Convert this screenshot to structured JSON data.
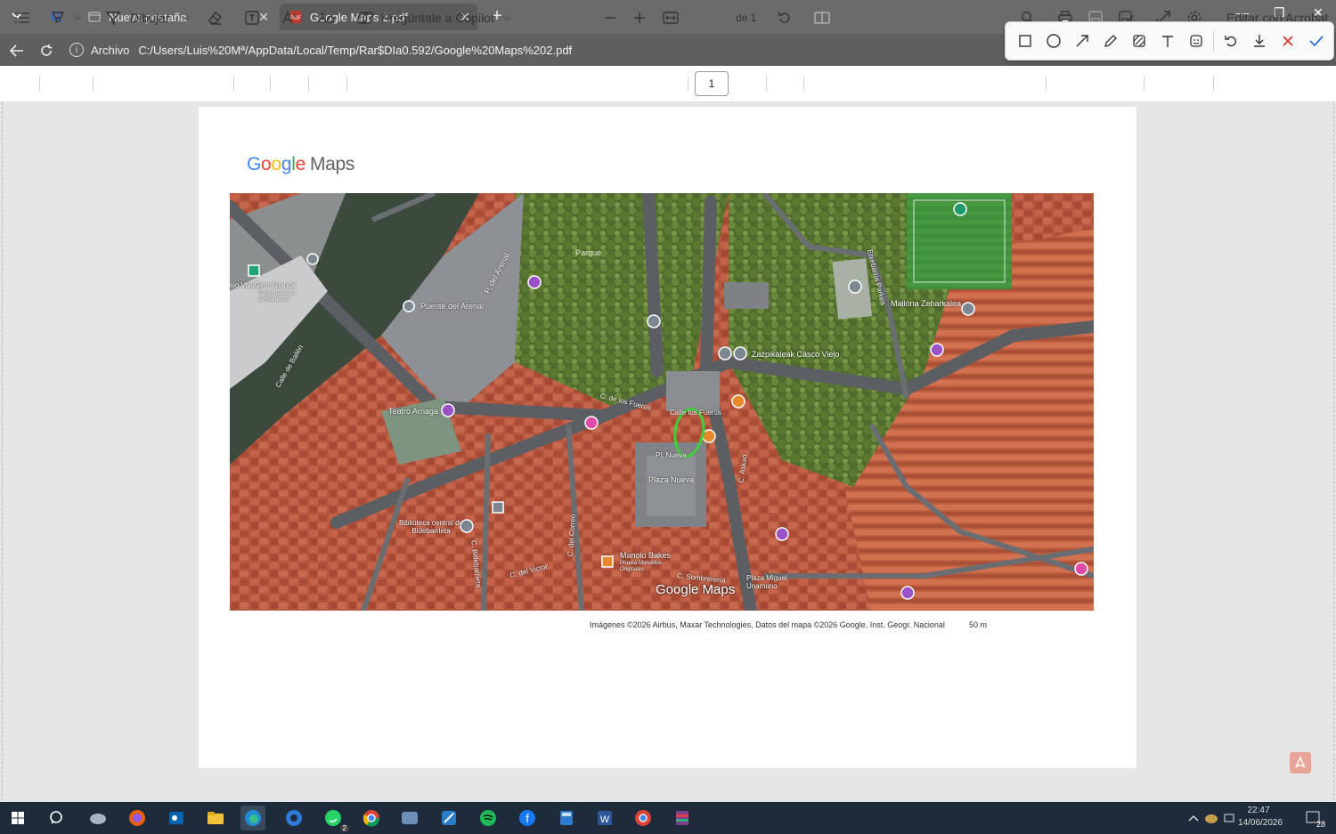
{
  "tabs": [
    {
      "label": "Nueva pestaña"
    },
    {
      "label": "Google Maps 2.pdf"
    }
  ],
  "address": {
    "scheme_label": "Archivo",
    "url": "C:/Users/Luis%20Mª/AppData/Local/Temp/Rar$DIa0.592/Google%20Maps%202.pdf"
  },
  "pdf_toolbar": {
    "draw_label": "Dibujar",
    "copilot_label": "Pregúntale a Copilot",
    "page_current": "1",
    "page_total": "de 1",
    "edit_acrobat_label": "Editar con Acrobat"
  },
  "document": {
    "logo_google": [
      "G",
      "o",
      "o",
      "g",
      "l",
      "e"
    ],
    "logo_maps": "Maps",
    "attribution": "Imágenes ©2026 Airbus, Maxar Technologies, Datos del mapa ©2026 Google, Inst. Geogr. Nacional",
    "scale": "50 m"
  },
  "map_labels": {
    "parque": "Parque",
    "puente": "Puente del Arenal",
    "arenal": "P. del Arenal",
    "teatro": "Teatro Arriaga",
    "zazpikaleak": "Zazpikaleak Casco Viejo",
    "mallona": "Mallona Zeharkalea",
    "plaza_nueva": "Plaza Nueva",
    "pl_nueva": "Pl. Nueva",
    "fueros1": "C. de los Fueros",
    "fueros2": "Calle los Fueros",
    "biblioteca": "Biblioteca central de Bidebarrieta",
    "manolo": "Manolo Bakes",
    "manolo_sub": "Prueba Manolitos Originales",
    "plaza_miguel": "Plaza Miguel Unamuno",
    "correo": "C. del Correo",
    "victor": "C. del Victor",
    "bidebarrieta": "C. Bidebarrieta",
    "askao": "C. Askao",
    "sombrereria": "C. Sombrerería",
    "bailen": "Calle de Bailén",
    "vivagym": "sio VivaGym Abande",
    "vivagym_sub": "Tu gimnasio sin permanencia",
    "etxebarria": "Etxebarria Parkea",
    "map_watermark": "Google Maps"
  },
  "taskbar": {
    "whatsapp_badge": "2",
    "time": "22:47",
    "date": "14/06/2026",
    "notif_count": "28"
  }
}
